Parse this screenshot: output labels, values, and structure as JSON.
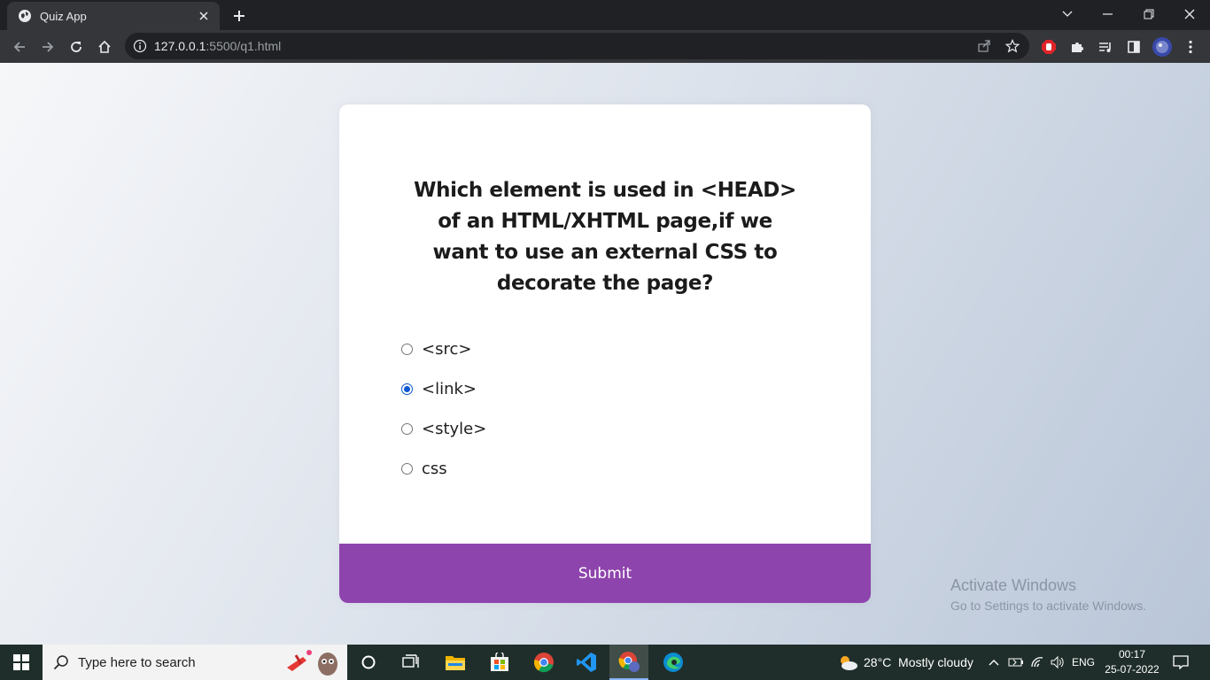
{
  "browser": {
    "tab_title": "Quiz App",
    "url_host": "127.0.0.1",
    "url_path": ":5500/q1.html"
  },
  "quiz": {
    "question": "Which element is used in <HEAD> of an HTML/XHTML page,if we want to use an external CSS to decorate the page?",
    "answers": [
      {
        "label": "<src>",
        "selected": false
      },
      {
        "label": "<link>",
        "selected": true
      },
      {
        "label": "<style>",
        "selected": false
      },
      {
        "label": "css",
        "selected": false
      }
    ],
    "submit_label": "Submit",
    "accent_color": "#8e44ad"
  },
  "watermark": {
    "line1": "Activate Windows",
    "line2": "Go to Settings to activate Windows."
  },
  "taskbar": {
    "search_placeholder": "Type here to search",
    "weather": "28°C  Mostly cloudy",
    "language": "ENG",
    "time": "00:17",
    "date": "25-07-2022"
  }
}
